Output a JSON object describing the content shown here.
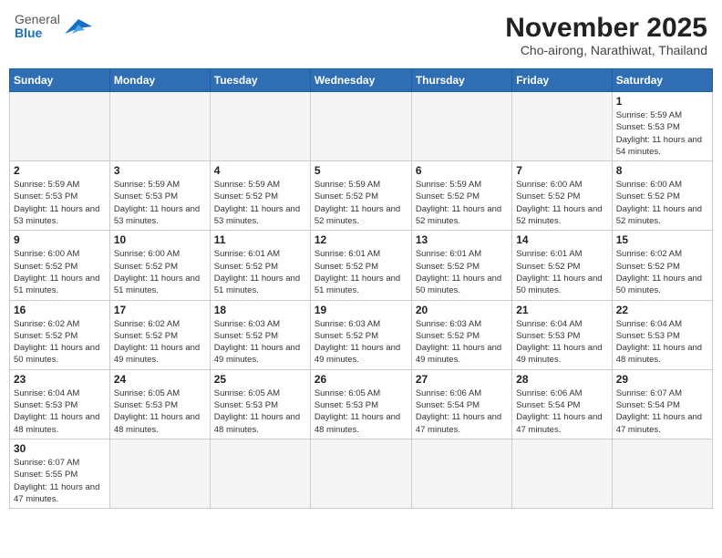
{
  "header": {
    "logo_general": "General",
    "logo_blue": "Blue",
    "month_title": "November 2025",
    "subtitle": "Cho-airong, Narathiwat, Thailand"
  },
  "weekdays": [
    "Sunday",
    "Monday",
    "Tuesday",
    "Wednesday",
    "Thursday",
    "Friday",
    "Saturday"
  ],
  "weeks": [
    [
      {
        "day": "",
        "sunrise": "",
        "sunset": "",
        "daylight": ""
      },
      {
        "day": "",
        "sunrise": "",
        "sunset": "",
        "daylight": ""
      },
      {
        "day": "",
        "sunrise": "",
        "sunset": "",
        "daylight": ""
      },
      {
        "day": "",
        "sunrise": "",
        "sunset": "",
        "daylight": ""
      },
      {
        "day": "",
        "sunrise": "",
        "sunset": "",
        "daylight": ""
      },
      {
        "day": "",
        "sunrise": "",
        "sunset": "",
        "daylight": ""
      },
      {
        "day": "1",
        "sunrise": "Sunrise: 5:59 AM",
        "sunset": "Sunset: 5:53 PM",
        "daylight": "Daylight: 11 hours and 54 minutes."
      }
    ],
    [
      {
        "day": "2",
        "sunrise": "Sunrise: 5:59 AM",
        "sunset": "Sunset: 5:53 PM",
        "daylight": "Daylight: 11 hours and 53 minutes."
      },
      {
        "day": "3",
        "sunrise": "Sunrise: 5:59 AM",
        "sunset": "Sunset: 5:53 PM",
        "daylight": "Daylight: 11 hours and 53 minutes."
      },
      {
        "day": "4",
        "sunrise": "Sunrise: 5:59 AM",
        "sunset": "Sunset: 5:52 PM",
        "daylight": "Daylight: 11 hours and 53 minutes."
      },
      {
        "day": "5",
        "sunrise": "Sunrise: 5:59 AM",
        "sunset": "Sunset: 5:52 PM",
        "daylight": "Daylight: 11 hours and 52 minutes."
      },
      {
        "day": "6",
        "sunrise": "Sunrise: 5:59 AM",
        "sunset": "Sunset: 5:52 PM",
        "daylight": "Daylight: 11 hours and 52 minutes."
      },
      {
        "day": "7",
        "sunrise": "Sunrise: 6:00 AM",
        "sunset": "Sunset: 5:52 PM",
        "daylight": "Daylight: 11 hours and 52 minutes."
      },
      {
        "day": "8",
        "sunrise": "Sunrise: 6:00 AM",
        "sunset": "Sunset: 5:52 PM",
        "daylight": "Daylight: 11 hours and 52 minutes."
      }
    ],
    [
      {
        "day": "9",
        "sunrise": "Sunrise: 6:00 AM",
        "sunset": "Sunset: 5:52 PM",
        "daylight": "Daylight: 11 hours and 51 minutes."
      },
      {
        "day": "10",
        "sunrise": "Sunrise: 6:00 AM",
        "sunset": "Sunset: 5:52 PM",
        "daylight": "Daylight: 11 hours and 51 minutes."
      },
      {
        "day": "11",
        "sunrise": "Sunrise: 6:01 AM",
        "sunset": "Sunset: 5:52 PM",
        "daylight": "Daylight: 11 hours and 51 minutes."
      },
      {
        "day": "12",
        "sunrise": "Sunrise: 6:01 AM",
        "sunset": "Sunset: 5:52 PM",
        "daylight": "Daylight: 11 hours and 51 minutes."
      },
      {
        "day": "13",
        "sunrise": "Sunrise: 6:01 AM",
        "sunset": "Sunset: 5:52 PM",
        "daylight": "Daylight: 11 hours and 50 minutes."
      },
      {
        "day": "14",
        "sunrise": "Sunrise: 6:01 AM",
        "sunset": "Sunset: 5:52 PM",
        "daylight": "Daylight: 11 hours and 50 minutes."
      },
      {
        "day": "15",
        "sunrise": "Sunrise: 6:02 AM",
        "sunset": "Sunset: 5:52 PM",
        "daylight": "Daylight: 11 hours and 50 minutes."
      }
    ],
    [
      {
        "day": "16",
        "sunrise": "Sunrise: 6:02 AM",
        "sunset": "Sunset: 5:52 PM",
        "daylight": "Daylight: 11 hours and 50 minutes."
      },
      {
        "day": "17",
        "sunrise": "Sunrise: 6:02 AM",
        "sunset": "Sunset: 5:52 PM",
        "daylight": "Daylight: 11 hours and 49 minutes."
      },
      {
        "day": "18",
        "sunrise": "Sunrise: 6:03 AM",
        "sunset": "Sunset: 5:52 PM",
        "daylight": "Daylight: 11 hours and 49 minutes."
      },
      {
        "day": "19",
        "sunrise": "Sunrise: 6:03 AM",
        "sunset": "Sunset: 5:52 PM",
        "daylight": "Daylight: 11 hours and 49 minutes."
      },
      {
        "day": "20",
        "sunrise": "Sunrise: 6:03 AM",
        "sunset": "Sunset: 5:52 PM",
        "daylight": "Daylight: 11 hours and 49 minutes."
      },
      {
        "day": "21",
        "sunrise": "Sunrise: 6:04 AM",
        "sunset": "Sunset: 5:53 PM",
        "daylight": "Daylight: 11 hours and 49 minutes."
      },
      {
        "day": "22",
        "sunrise": "Sunrise: 6:04 AM",
        "sunset": "Sunset: 5:53 PM",
        "daylight": "Daylight: 11 hours and 48 minutes."
      }
    ],
    [
      {
        "day": "23",
        "sunrise": "Sunrise: 6:04 AM",
        "sunset": "Sunset: 5:53 PM",
        "daylight": "Daylight: 11 hours and 48 minutes."
      },
      {
        "day": "24",
        "sunrise": "Sunrise: 6:05 AM",
        "sunset": "Sunset: 5:53 PM",
        "daylight": "Daylight: 11 hours and 48 minutes."
      },
      {
        "day": "25",
        "sunrise": "Sunrise: 6:05 AM",
        "sunset": "Sunset: 5:53 PM",
        "daylight": "Daylight: 11 hours and 48 minutes."
      },
      {
        "day": "26",
        "sunrise": "Sunrise: 6:05 AM",
        "sunset": "Sunset: 5:53 PM",
        "daylight": "Daylight: 11 hours and 48 minutes."
      },
      {
        "day": "27",
        "sunrise": "Sunrise: 6:06 AM",
        "sunset": "Sunset: 5:54 PM",
        "daylight": "Daylight: 11 hours and 47 minutes."
      },
      {
        "day": "28",
        "sunrise": "Sunrise: 6:06 AM",
        "sunset": "Sunset: 5:54 PM",
        "daylight": "Daylight: 11 hours and 47 minutes."
      },
      {
        "day": "29",
        "sunrise": "Sunrise: 6:07 AM",
        "sunset": "Sunset: 5:54 PM",
        "daylight": "Daylight: 11 hours and 47 minutes."
      }
    ],
    [
      {
        "day": "30",
        "sunrise": "Sunrise: 6:07 AM",
        "sunset": "Sunset: 5:55 PM",
        "daylight": "Daylight: 11 hours and 47 minutes."
      },
      {
        "day": "",
        "sunrise": "",
        "sunset": "",
        "daylight": ""
      },
      {
        "day": "",
        "sunrise": "",
        "sunset": "",
        "daylight": ""
      },
      {
        "day": "",
        "sunrise": "",
        "sunset": "",
        "daylight": ""
      },
      {
        "day": "",
        "sunrise": "",
        "sunset": "",
        "daylight": ""
      },
      {
        "day": "",
        "sunrise": "",
        "sunset": "",
        "daylight": ""
      },
      {
        "day": "",
        "sunrise": "",
        "sunset": "",
        "daylight": ""
      }
    ]
  ]
}
